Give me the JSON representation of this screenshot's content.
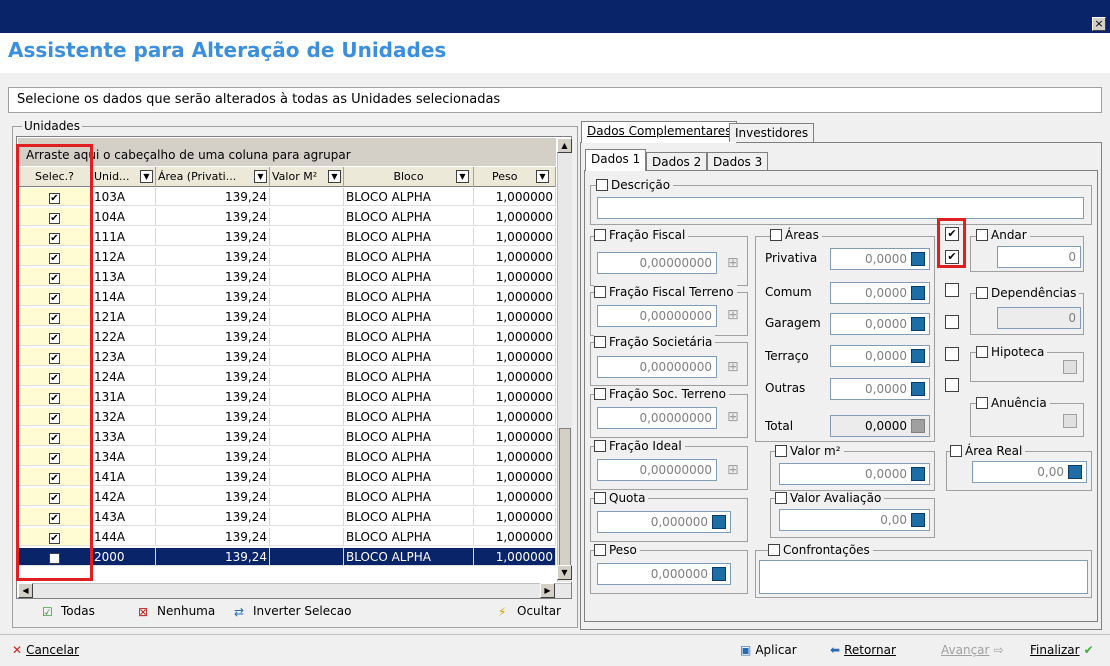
{
  "window": {
    "close_label": "×"
  },
  "header": {
    "title": "Assistente para Alteração de Unidades"
  },
  "instruction": "Selecione os dados que serão alterados à todas as Unidades selecionadas",
  "unidades": {
    "group_label": "Unidades",
    "group_hint": "Arraste aqui o cabeçalho de uma coluna para agrupar",
    "columns": [
      "Selec.?",
      "Unid...",
      "Área (Privati...",
      "Valor M²",
      "Bloco",
      "Peso"
    ],
    "rows": [
      {
        "unid": "103A",
        "area": "139,24",
        "valor": "",
        "bloco": "BLOCO ALPHA",
        "peso": "1,000000"
      },
      {
        "unid": "104A",
        "area": "139,24",
        "valor": "",
        "bloco": "BLOCO ALPHA",
        "peso": "1,000000"
      },
      {
        "unid": "111A",
        "area": "139,24",
        "valor": "",
        "bloco": "BLOCO ALPHA",
        "peso": "1,000000"
      },
      {
        "unid": "112A",
        "area": "139,24",
        "valor": "",
        "bloco": "BLOCO ALPHA",
        "peso": "1,000000"
      },
      {
        "unid": "113A",
        "area": "139,24",
        "valor": "",
        "bloco": "BLOCO ALPHA",
        "peso": "1,000000"
      },
      {
        "unid": "114A",
        "area": "139,24",
        "valor": "",
        "bloco": "BLOCO ALPHA",
        "peso": "1,000000"
      },
      {
        "unid": "121A",
        "area": "139,24",
        "valor": "",
        "bloco": "BLOCO ALPHA",
        "peso": "1,000000"
      },
      {
        "unid": "122A",
        "area": "139,24",
        "valor": "",
        "bloco": "BLOCO ALPHA",
        "peso": "1,000000"
      },
      {
        "unid": "123A",
        "area": "139,24",
        "valor": "",
        "bloco": "BLOCO ALPHA",
        "peso": "1,000000"
      },
      {
        "unid": "124A",
        "area": "139,24",
        "valor": "",
        "bloco": "BLOCO ALPHA",
        "peso": "1,000000"
      },
      {
        "unid": "131A",
        "area": "139,24",
        "valor": "",
        "bloco": "BLOCO ALPHA",
        "peso": "1,000000"
      },
      {
        "unid": "132A",
        "area": "139,24",
        "valor": "",
        "bloco": "BLOCO ALPHA",
        "peso": "1,000000"
      },
      {
        "unid": "133A",
        "area": "139,24",
        "valor": "",
        "bloco": "BLOCO ALPHA",
        "peso": "1,000000"
      },
      {
        "unid": "134A",
        "area": "139,24",
        "valor": "",
        "bloco": "BLOCO ALPHA",
        "peso": "1,000000"
      },
      {
        "unid": "141A",
        "area": "139,24",
        "valor": "",
        "bloco": "BLOCO ALPHA",
        "peso": "1,000000"
      },
      {
        "unid": "142A",
        "area": "139,24",
        "valor": "",
        "bloco": "BLOCO ALPHA",
        "peso": "1,000000"
      },
      {
        "unid": "143A",
        "area": "139,24",
        "valor": "",
        "bloco": "BLOCO ALPHA",
        "peso": "1,000000"
      },
      {
        "unid": "144A",
        "area": "139,24",
        "valor": "",
        "bloco": "BLOCO ALPHA",
        "peso": "1,000000"
      },
      {
        "unid": "2000",
        "area": "139,24",
        "valor": "",
        "bloco": "BLOCO ALPHA",
        "peso": "1,000000"
      }
    ],
    "check_mark": "✔",
    "buttons": {
      "todas": "Todas",
      "nenhuma": "Nenhuma",
      "inverter": "Inverter Selecao",
      "ocultar": "Ocultar"
    }
  },
  "tabs": {
    "main": [
      "Dados Complementares",
      "Investidores"
    ],
    "sub": [
      "Dados 1",
      "Dados 2",
      "Dados 3"
    ]
  },
  "form": {
    "descricao": "Descrição",
    "fracao_fiscal": {
      "label": "Fração Fiscal",
      "value": "0,00000000"
    },
    "fracao_fiscal_terreno": {
      "label": "Fração Fiscal Terreno",
      "value": "0,00000000"
    },
    "fracao_societaria": {
      "label": "Fração Societária",
      "value": "0,00000000"
    },
    "fracao_soc_terreno": {
      "label": "Fração Soc. Terreno",
      "value": "0,00000000"
    },
    "fracao_ideal": {
      "label": "Fração Ideal",
      "value": "0,00000000"
    },
    "quota": {
      "label": "Quota",
      "value": "0,000000"
    },
    "peso": {
      "label": "Peso",
      "value": "0,000000"
    },
    "areas": {
      "label": "Áreas",
      "privativa": "Privativa",
      "comum": "Comum",
      "garagem": "Garagem",
      "terraco": "Terraço",
      "outras": "Outras",
      "total": "Total",
      "value": "0,0000"
    },
    "andar": {
      "label": "Andar",
      "value": "0"
    },
    "dependencias": {
      "label": "Dependências",
      "value": "0"
    },
    "hipoteca": "Hipoteca",
    "anuencia": "Anuência",
    "valor_m2": {
      "label": "Valor m²",
      "value": "0,0000"
    },
    "area_real": {
      "label": "Área Real",
      "value": "0,00"
    },
    "valor_avaliacao": {
      "label": "Valor Avaliação",
      "value": "0,00"
    },
    "confrontacoes": "Confrontações"
  },
  "footer": {
    "cancelar": "Cancelar",
    "aplicar": "Aplicar",
    "retornar": "Retornar",
    "avancar": "Avançar",
    "finalizar": "Finalizar"
  }
}
